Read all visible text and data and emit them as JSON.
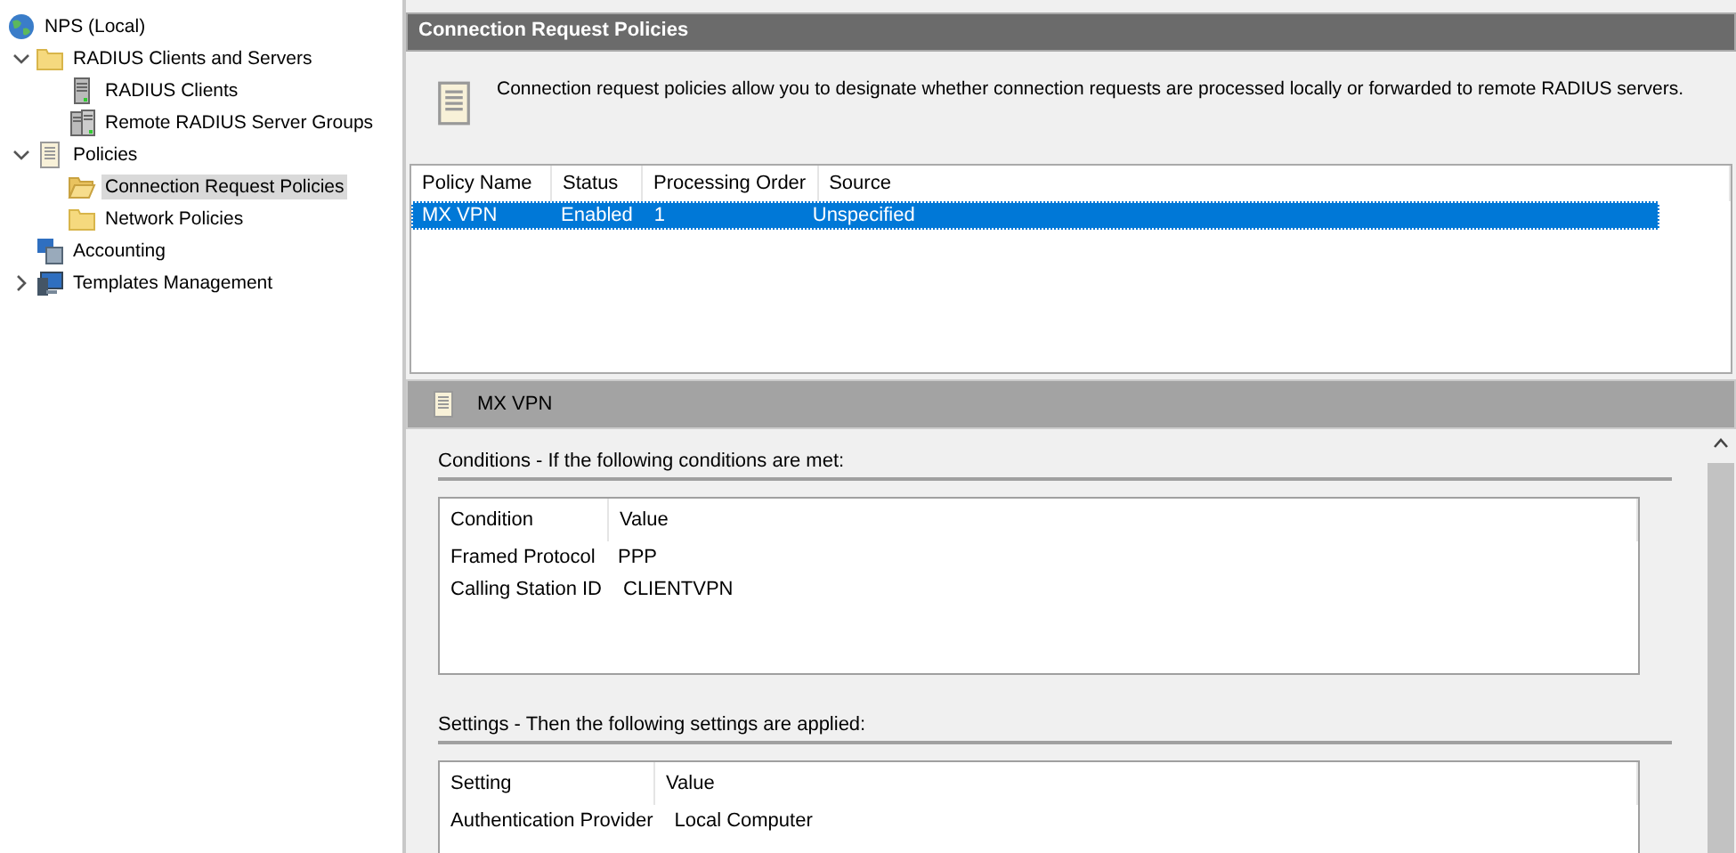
{
  "tree": [
    {
      "label": "NPS (Local)",
      "kind": "globe",
      "selected": false,
      "children": [
        {
          "label": "RADIUS Clients and Servers",
          "kind": "folder",
          "selected": false,
          "expanded": true,
          "children": [
            {
              "label": "RADIUS Clients",
              "kind": "server",
              "selected": false
            },
            {
              "label": "Remote RADIUS Server Groups",
              "kind": "servers",
              "selected": false
            }
          ]
        },
        {
          "label": "Policies",
          "kind": "scroll",
          "selected": false,
          "expanded": true,
          "children": [
            {
              "label": "Connection Request Policies",
              "kind": "folder-open",
              "selected": true
            },
            {
              "label": "Network Policies",
              "kind": "folder",
              "selected": false
            }
          ]
        },
        {
          "label": "Accounting",
          "kind": "accounting",
          "selected": false
        },
        {
          "label": "Templates Management",
          "kind": "templates",
          "selected": false,
          "expanded": false
        }
      ]
    }
  ],
  "main": {
    "title": "Connection Request Policies",
    "description": "Connection request policies allow you to designate whether connection requests are processed locally or forwarded to remote RADIUS servers.",
    "policies": {
      "columns": [
        "Policy Name",
        "Status",
        "Processing Order",
        "Source"
      ],
      "rows": [
        {
          "cells": [
            "MX VPN",
            "Enabled",
            "1",
            "Unspecified"
          ],
          "selected": true
        }
      ]
    },
    "detail": {
      "title": "MX VPN",
      "sections": [
        {
          "heading": "Conditions - If the following conditions are met:",
          "columns": [
            "Condition",
            "Value"
          ],
          "rows": [
            [
              "Framed Protocol",
              "PPP"
            ],
            [
              "Calling Station ID",
              "CLIENTVPN"
            ]
          ]
        },
        {
          "heading": "Settings - Then the following settings are applied:",
          "columns": [
            "Setting",
            "Value"
          ],
          "rows": [
            [
              "Authentication Provider",
              "Local Computer"
            ]
          ]
        }
      ]
    }
  }
}
